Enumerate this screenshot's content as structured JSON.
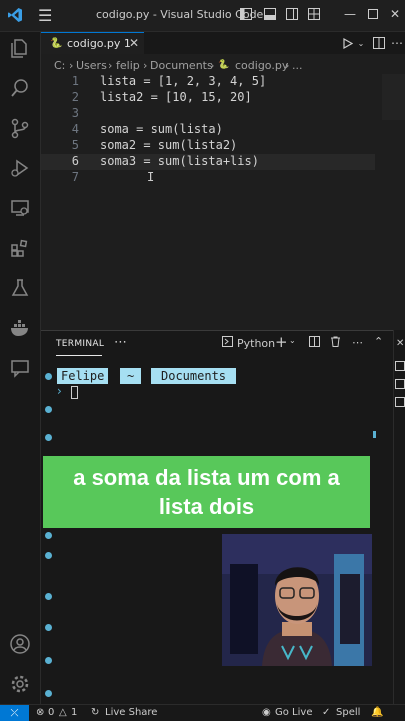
{
  "titlebar": {
    "menu_icon": "hamburger-menu-icon",
    "title": "codigo.py - Visual Studio Code"
  },
  "tab": {
    "file_icon": "python-file-icon",
    "label": "codigo.py 1"
  },
  "breadcrumb": {
    "drive": "C:",
    "users": "Users",
    "user": "felip",
    "folder": "Documents",
    "file": "codigo.py",
    "more": "..."
  },
  "editor": {
    "lines": [
      {
        "num": "1",
        "text": "lista = [1, 2, 3, 4, 5]"
      },
      {
        "num": "2",
        "text": "lista2 = [10, 15, 20]"
      },
      {
        "num": "3",
        "text": ""
      },
      {
        "num": "4",
        "text": "soma = sum(lista)"
      },
      {
        "num": "5",
        "text": "soma2 = sum(lista2)"
      },
      {
        "num": "6",
        "text": "soma3 = sum(lista+lis)"
      },
      {
        "num": "7",
        "text": ""
      }
    ],
    "active_line": "6"
  },
  "panel": {
    "tab_label": "TERMINAL",
    "shell_label": "Python"
  },
  "terminal": {
    "user": "Felipe",
    "home": "~",
    "dir": "Documents",
    "prompt_char": "›"
  },
  "caption": "a soma da lista um com a lista dois",
  "statusbar": {
    "errors": "0",
    "warnings": "1",
    "live_share": "Live Share",
    "go_live": "Go Live",
    "spell": "Spell"
  },
  "colors": {
    "accent": "#0078d4",
    "caption_bg": "#58c85a",
    "prompt_bg": "#a6dff2"
  }
}
